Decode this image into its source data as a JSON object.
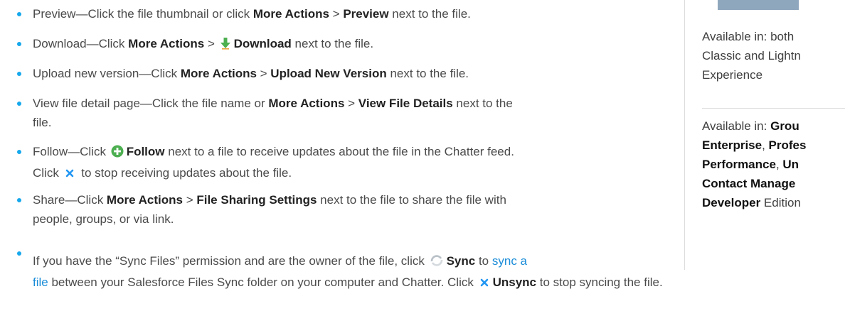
{
  "items": [
    {
      "text_pre": "Preview—Click the file thumbnail or click ",
      "b1": "More Actions",
      "sep": " > ",
      "b2": "Preview",
      "text_post": " next to the file."
    },
    {
      "text_pre": "Download—Click ",
      "b1": "More Actions",
      "sep": " > ",
      "b2": "Download",
      "text_post": " next to the file."
    },
    {
      "text_pre": "Upload new version—Click ",
      "b1": "More Actions",
      "sep": " > ",
      "b2": "Upload New Version",
      "text_post": " next to the file."
    },
    {
      "text_pre": "View file detail page—Click the file name or ",
      "b1": "More Actions",
      "sep": " > ",
      "b2": "View File Details",
      "text_post": " next to the",
      "line2": "file."
    },
    {
      "text_pre": "Follow—Click ",
      "b1": "Follow",
      "text_post": " next to a file to receive updates about the file in the Chatter feed.",
      "line2_pre": "Click ",
      "line2_post": " to stop receiving updates about the file."
    },
    {
      "text_pre": "Share—Click ",
      "b1": "More Actions",
      "sep": " > ",
      "b2": "File Sharing Settings",
      "text_post": " next to the file to share the file with",
      "line2": "people, groups, or via link."
    },
    {
      "text_pre": "If you have the “Sync Files” permission and are the owner of the file, click ",
      "b1": "Sync",
      "text_mid": " to ",
      "link1": "sync a",
      "link2": "file",
      "line2_post": " between your Salesforce Files Sync folder on your computer and Chatter. Click ",
      "b2": "Unsync",
      "line2_end": " to stop syncing the file."
    }
  ],
  "sidebar": {
    "avail1_l1": "Available in: both",
    "avail1_l2": "Classic and Lightn",
    "avail1_l3": "Experience",
    "avail2_l1": "Available in: ",
    "avail2_l1b": "Grou",
    "e1": "Enterprise",
    "comma1": ", ",
    "e2": "Profes",
    "e3": "Performance",
    "comma2": ", ",
    "e4": "Un",
    "e5": "Contact Manage",
    "e6": "Developer",
    "edition": " Edition"
  },
  "colors": {
    "bullet": "#16a8ec",
    "link": "#1a8cd8",
    "follow_icon": "#4caf50",
    "download_icon": "#4caf50",
    "close_icon": "#2196f3"
  }
}
